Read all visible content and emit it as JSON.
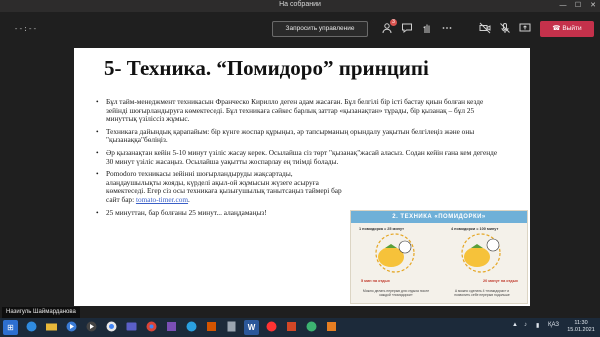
{
  "window": {
    "title": "На собрании",
    "minimize": "—",
    "maximize": "☐",
    "close": "✕"
  },
  "meeting": {
    "timer": "--:--",
    "request_control_label": "Запросить управление",
    "participants_badge": "3",
    "leave_label": "Выйти"
  },
  "slide": {
    "title": "5- Техника. “Помидоро” принципі",
    "bullets": [
      "Бұл тайм-менеджмент техникасын Франческо Кирилло деген адам жасаған. Бұл белгілі бір істі бастау қиын болған кезде зейінді шоғырландыруға көмектеседі. Бұл техникаға сәйкес барлық заттар «қызанақтан» тұрады, бір қызанақ – бұл 25 минуттық үзіліссіз жұмыс.",
      "Техникаға дайындық қарапайым: бір күнге жоспар құрыңыз, әр тапсырманың орындалу уақытын белгілеңіз және оны \"қызанаққа\"бөліңіз.",
      "Әр қызанақтан кейін 5-10 минут үзіліс жасау керек. Осылайша сіз төрт \"қызанақ\"жасай аласыз. Содан кейін ғана кем дегенде 30 минут үзіліс жасаңыз. Осылайша уақытты жоспарлау ең тиімді болады."
    ],
    "bullet4_text": "Pomodoro техникасы зейінні шоғырландыруды жақсартады, алаңдаушылықты жояды, күрделі ақыл-ой жұмысын жүзеге асыруға көмектеседі. Егер сіз осы техникаға қызығушылық танытсаңыз таймері бар сайт бар: ",
    "bullet4_link": "tomato-timer.com",
    "bullet4_end": ".",
    "bullet5": " 25 минуттан, бар болғаны 25 минут... алаңдамаңыз!"
  },
  "picture": {
    "header": "2. ТЕХНИКА «ПОМИДОРКИ»",
    "left_label": "1 помидорка = 25 минут",
    "right_label": "4 помидорки = 100 минут",
    "left_tag": "5 мин на отдых",
    "right_tag": "20 минут на отдых",
    "left_caption": "Можно делать перерыв для отдыха после каждой «помидорки»",
    "right_caption": "А можно сделать 4 «помидорки» и позволить себе перерыв подольше"
  },
  "presenter": {
    "name": "Назигуль Шаймарданова"
  },
  "taskbar": {
    "lang": "ҚАЗ",
    "time": "11:30",
    "date": "15.01.2021"
  }
}
